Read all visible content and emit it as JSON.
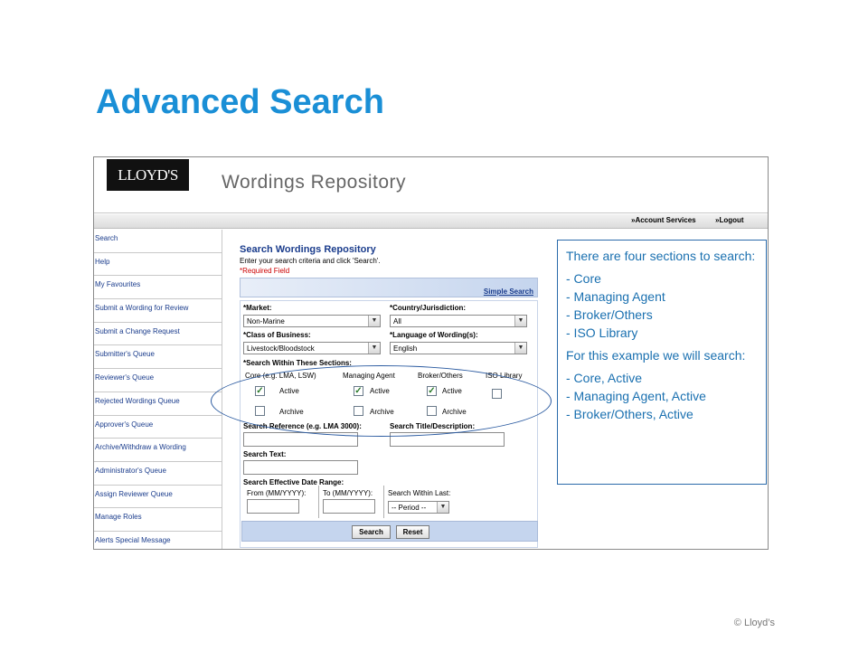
{
  "slide": {
    "title": "Advanced Search",
    "copyright": "© Lloyd’s"
  },
  "app": {
    "logo_text": "LLOYD'S",
    "title": "Wordings Repository",
    "topnav": {
      "account_services": "»Account Services",
      "logout": "»Logout"
    },
    "sidebar_items": [
      "Search",
      "Help",
      "My Favourites",
      "Submit a Wording for Review",
      "Submit a Change Request",
      "Submitter's Queue",
      "Reviewer's Queue",
      "Rejected Wordings Queue",
      "Approver's Queue",
      "Archive/Withdraw a Wording",
      "Administrator's Queue",
      "Assign Reviewer Queue",
      "Manage Roles",
      "Alerts Special Message"
    ],
    "form": {
      "title": "Search Wordings Repository",
      "instructions": "Enter your search criteria and click 'Search'.",
      "required_note": "*Required Field",
      "simple_search_link": "Simple Search",
      "market_label": "*Market:",
      "market_value": "Non-Marine",
      "country_label": "*Country/Jurisdiction:",
      "country_value": "All",
      "class_label": "*Class of Business:",
      "class_value": "Livestock/Bloodstock",
      "language_label": "*Language of Wording(s):",
      "language_value": "English",
      "sections_label": "*Search Within These Sections:",
      "section_headers": [
        "Core (e.g. LMA, LSW)",
        "Managing Agent",
        "Broker/Others",
        "ISO Library"
      ],
      "active_label": "Active",
      "archive_label": "Archive",
      "checkboxes": {
        "core_active": true,
        "managing_active": true,
        "broker_active": true,
        "iso": false,
        "core_archive": false,
        "managing_archive": false,
        "broker_archive": false
      },
      "search_reference_label": "Search Reference (e.g. LMA 3000):",
      "search_title_label": "Search Title/Description:",
      "search_text_label": "Search Text:",
      "date_range_label": "Search Effective Date Range:",
      "from_label": "From (MM/YYYY):",
      "to_label": "To (MM/YYYY):",
      "within_last_label": "Search Within Last:",
      "period_value": "-- Period --",
      "search_button": "Search",
      "reset_button": "Reset"
    }
  },
  "callout": {
    "intro": "There are four sections to search:",
    "sections": [
      "- Core",
      "- Managing Agent",
      "- Broker/Others",
      "- ISO Library"
    ],
    "example_intro": "For this example we will search:",
    "example_items": [
      "- Core, Active",
      "- Managing Agent, Active",
      "- Broker/Others, Active"
    ]
  },
  "colors": {
    "title_blue": "#1a8fd6",
    "callout_blue": "#1a70b0",
    "link_blue": "#1a3c8c",
    "required_red": "#cc0000"
  }
}
